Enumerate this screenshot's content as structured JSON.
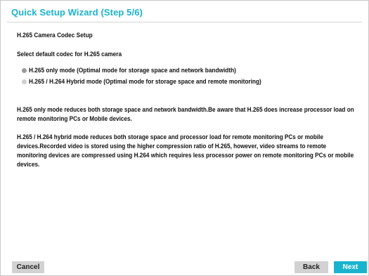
{
  "wizard": {
    "title": "Quick Setup Wizard (Step 5/6)"
  },
  "codec_setup": {
    "heading": "H.265 Camera Codec Setup",
    "select_label": "Select default codec for H.265 camera",
    "options": [
      {
        "label": "H.265 only mode (Optimal mode for storage space and network bandwidth)",
        "selected": true
      },
      {
        "label": "H.265 / H.264 Hybrid mode (Optimal mode for storage space and remote monitoring)",
        "selected": false
      }
    ],
    "descriptions": [
      "H.265 only mode reduces both storage space and network bandwidth.Be aware that H.265 does increase processor load on remote monitoring PCs or Mobile devices.",
      "H.265 / H.264 hybrid mode reduces both storage space and processor load for remote monitoring PCs or mobile devices.Recorded video is stored using the higher compression ratio of H.265, however, video streams to remote monitoring devices are compressed using H.264 which requires less processor power on remote monitoring PCs or mobile devices."
    ]
  },
  "footer": {
    "cancel_label": "Cancel",
    "back_label": "Back",
    "next_label": "Next"
  },
  "colors": {
    "accent": "#1ab3cf",
    "button_gray": "#d2d2d2"
  }
}
